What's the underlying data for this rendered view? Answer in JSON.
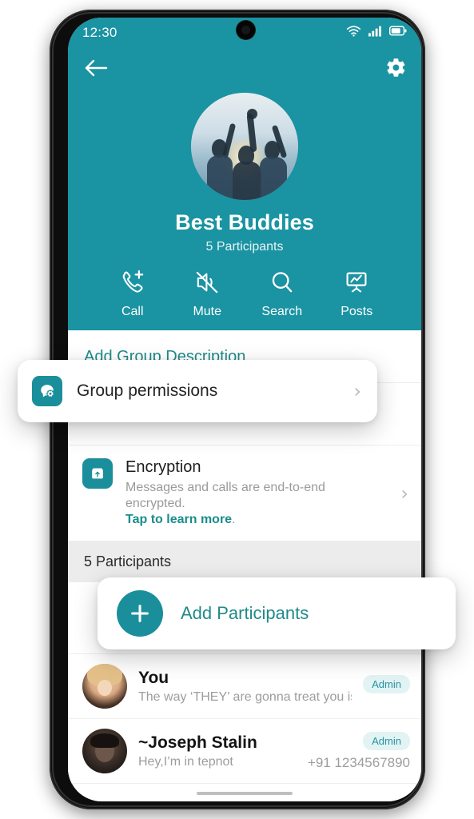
{
  "theme": {
    "header_teal": "#1a93a2",
    "accent_teal": "#1f8a8a",
    "icon_tile_teal": "#1a8f9b",
    "badge_bg": "#e2f3f4",
    "badge_text": "#2a93a0",
    "section_bg": "#ececec"
  },
  "statusbar": {
    "time": "12:30",
    "wifi_icon": "wifi-icon",
    "signal_icon": "cellular-signal-icon",
    "battery_icon": "battery-icon"
  },
  "topbar": {
    "back_icon": "back-arrow-icon",
    "settings_icon": "gear-icon"
  },
  "group": {
    "avatar_icon": "group-photo-avatar",
    "name": "Best Buddies",
    "participants_label": "5 Participants"
  },
  "actions": [
    {
      "label": "Call",
      "icon": "phone-add-icon"
    },
    {
      "label": "Mute",
      "icon": "speaker-mute-icon"
    },
    {
      "label": "Search",
      "icon": "search-icon"
    },
    {
      "label": "Posts",
      "icon": "presentation-board-icon"
    }
  ],
  "description_row": {
    "label": "Add Group Description"
  },
  "permissions_card": {
    "icon": "group-permissions-icon",
    "label": "Group permissions",
    "chevron_icon": "chevron-right-icon"
  },
  "encryption_row": {
    "icon": "lock-shield-icon",
    "title": "Encryption",
    "subtitle": "Messages and calls are end-to-end encrypted.",
    "link_text": "Tap to learn more",
    "link_suffix": ".",
    "chevron_icon": "chevron-right-icon"
  },
  "participants_section": {
    "header": "5 Participants",
    "add_card": {
      "icon": "plus-icon",
      "label": "Add Participants"
    },
    "items": [
      {
        "avatar": "avatar-you",
        "name": "You",
        "status": "The way ‘THEY’ are gonna treat you  is....",
        "badge": "Admin",
        "phone": ""
      },
      {
        "avatar": "avatar-joseph-stalin",
        "name": "~Joseph Stalin",
        "status": "Hey,I’m in tepnot",
        "badge": "Admin",
        "phone": "+91 1234567890"
      }
    ]
  }
}
